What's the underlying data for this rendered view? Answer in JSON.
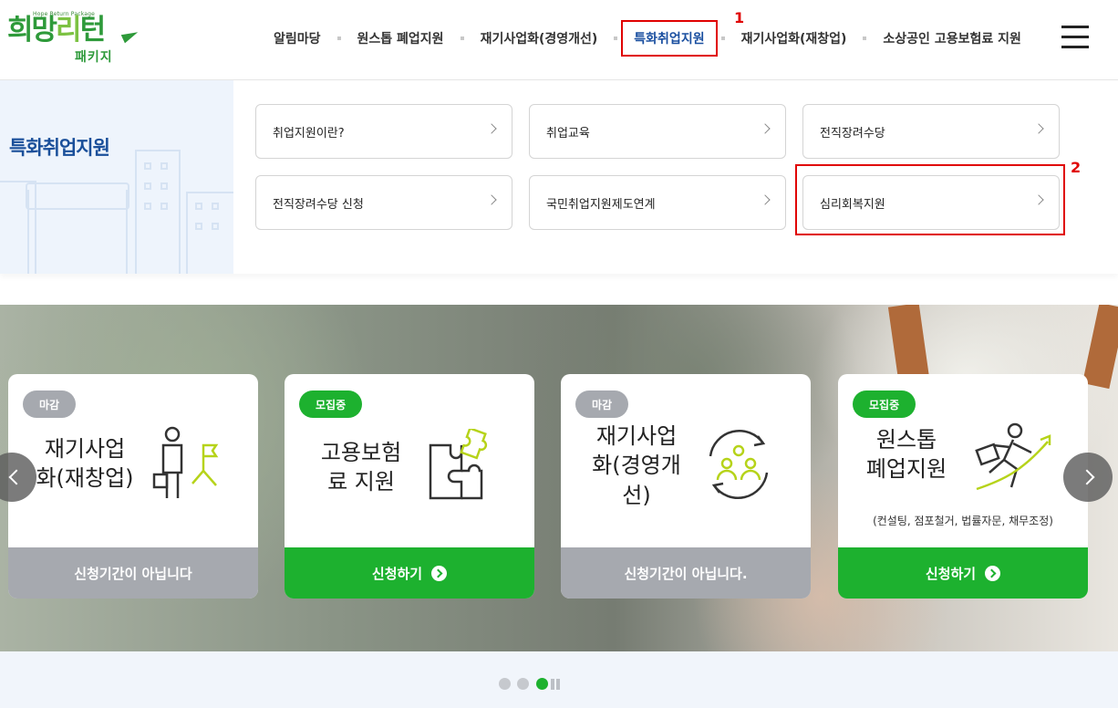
{
  "logo": {
    "tagline": "Hope Return Package",
    "name_a": "희망",
    "name_b": "리",
    "name_c": "턴",
    "sub": "패키지"
  },
  "nav": {
    "items": [
      {
        "label": "알림마당"
      },
      {
        "label": "원스톱 폐업지원"
      },
      {
        "label": "재기사업화(경영개선)"
      },
      {
        "label": "특화취업지원"
      },
      {
        "label": "재기사업화(재창업)"
      },
      {
        "label": "소상공인 고용보험료 지원"
      }
    ],
    "active_index": 3,
    "marker": "1"
  },
  "submenu": {
    "title": "특화취업지원",
    "marker": "2",
    "items": [
      {
        "label": "취업지원이란?"
      },
      {
        "label": "취업교육"
      },
      {
        "label": "전직장려수당"
      },
      {
        "label": "전직장려수당 신청"
      },
      {
        "label": "국민취업지원제도연계"
      },
      {
        "label": "심리회복지원"
      }
    ]
  },
  "cards": [
    {
      "badge": "마감",
      "status": "closed",
      "title_line1": "재기사업",
      "title_line2": "화(재창업)",
      "footer": "신청기간이 아닙니다",
      "icon": "entrepreneur-flag-icon"
    },
    {
      "badge": "모집중",
      "status": "open",
      "title_line1": "고용보험",
      "title_line2": "료 지원",
      "footer": "신청하기",
      "icon": "puzzle-icon"
    },
    {
      "badge": "마감",
      "status": "closed",
      "title_line1": "재기사업",
      "title_line2": "화(경영개",
      "title_line3": "선)",
      "footer": "신청기간이 아닙니다.",
      "icon": "team-cycle-icon"
    },
    {
      "badge": "모집중",
      "status": "open",
      "title_line1": "원스톱",
      "title_line2": "폐업지원",
      "note": "(컨설팅, 점포철거, 법률자문, 채무조정)",
      "footer": "신청하기",
      "icon": "running-man-icon"
    }
  ],
  "colors": {
    "accent_green": "#1db12f",
    "closed_gray": "#a6a9af",
    "nav_active": "#1a4fa0",
    "highlight_red": "#e00000"
  }
}
